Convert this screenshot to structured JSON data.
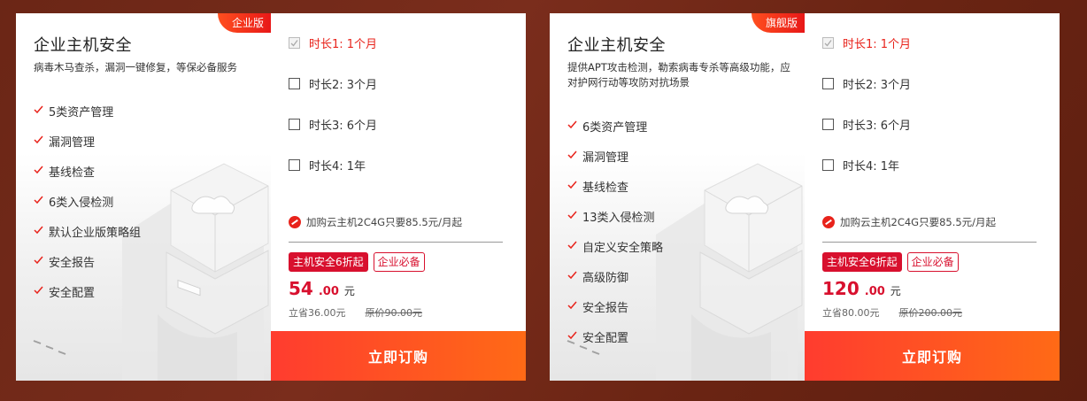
{
  "cards": [
    {
      "badge": "企业版",
      "title": "企业主机安全",
      "description": "病毒木马查杀，漏洞一键修复，等保必备服务",
      "features": [
        "5类资产管理",
        "漏洞管理",
        "基线检查",
        "6类入侵检测",
        "默认企业版策略组",
        "安全报告",
        "安全配置"
      ],
      "options": [
        "时长1: 1个月",
        "时长2: 3个月",
        "时长3: 6个月",
        "时长4: 1年"
      ],
      "selected_option": 0,
      "promo": "加购云主机2C4G只要85.5元/月起",
      "tag_discount": "主机安全6折起",
      "tag_essential": "企业必备",
      "price_int": "54",
      "price_dec": ".00",
      "price_unit": "元",
      "saved": "立省36.00元",
      "original": "原价90.00元",
      "buy_label": "立即订购"
    },
    {
      "badge": "旗舰版",
      "title": "企业主机安全",
      "description": "提供APT攻击检测，勒索病毒专杀等高级功能，应对护网行动等攻防对抗场景",
      "features": [
        "6类资产管理",
        "漏洞管理",
        "基线检查",
        "13类入侵检测",
        "自定义安全策略",
        "高级防御",
        "安全报告",
        "安全配置"
      ],
      "options": [
        "时长1: 1个月",
        "时长2: 3个月",
        "时长3: 6个月",
        "时长4: 1年"
      ],
      "selected_option": 0,
      "promo": "加购云主机2C4G只要85.5元/月起",
      "tag_discount": "主机安全6折起",
      "tag_essential": "企业必备",
      "price_int": "120",
      "price_dec": ".00",
      "price_unit": "元",
      "saved": "立省80.00元",
      "original": "原价200.00元",
      "buy_label": "立即订购"
    }
  ],
  "colors": {
    "accent": "#d8102e",
    "badge": "#e8231b",
    "buy_start": "#ff3c2f",
    "buy_end": "#ff6a16",
    "background": "#6b2616"
  }
}
